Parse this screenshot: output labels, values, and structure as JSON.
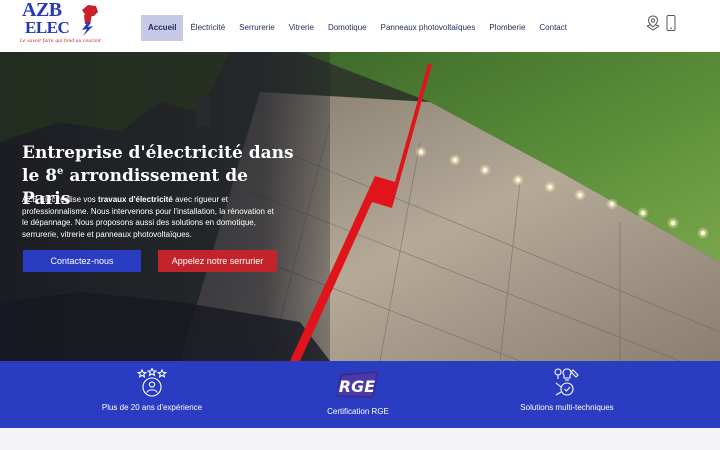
{
  "brand": {
    "line1": "AZB",
    "line2": "ELEC",
    "tagline": "Le savoir faire qui fond au courant"
  },
  "nav": {
    "items": [
      {
        "label": "Accueil",
        "active": true
      },
      {
        "label": "Électricité"
      },
      {
        "label": "Serrurerie"
      },
      {
        "label": "Vitrerie"
      },
      {
        "label": "Domotique"
      },
      {
        "label": "Panneaux photovoltaïques"
      },
      {
        "label": "Plomberie"
      },
      {
        "label": "Contact"
      }
    ]
  },
  "header_icons": [
    "location-pin-icon",
    "mobile-phone-icon"
  ],
  "hero": {
    "title_part1": "Entreprise d'électricité dans le 8",
    "title_sup": "e",
    "title_part2": " arrondissement de Paris",
    "text_before": "AZB Elec réalise vos ",
    "text_bold": "travaux d'électricité",
    "text_after": " avec rigueur et professionnalisme. Nous intervenons pour l'installation, la rénovation et le dépannage. Nous proposons aussi des solutions en domotique, serrurerie, vitrerie et panneaux photovoltaïques.",
    "cta_primary": "Contactez-nous",
    "cta_secondary": "Appelez notre serrurier"
  },
  "features": [
    {
      "icon": "stars-person-icon",
      "label": "Plus de 20 ans d'expérience"
    },
    {
      "icon": "rge-badge-icon",
      "icon_text": "RGE",
      "label": "Certification RGE"
    },
    {
      "icon": "multi-tools-icon",
      "label": "Solutions multi-techniques"
    }
  ],
  "colors": {
    "brand_blue": "#2a3cc2",
    "brand_red": "#c3242b",
    "nav_active_bg": "#c6cae6"
  }
}
